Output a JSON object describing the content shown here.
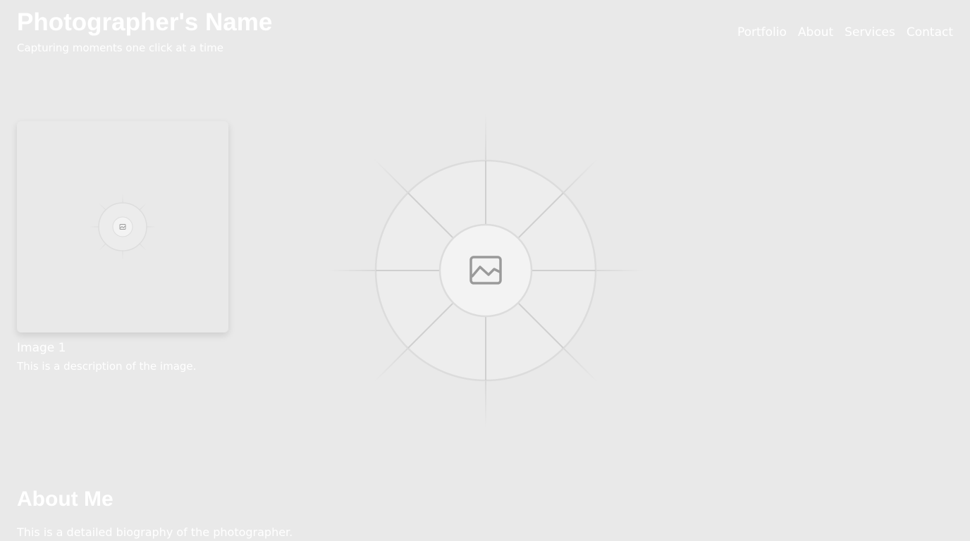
{
  "header": {
    "title": "Photographer's Name",
    "tagline": "Capturing moments one click at a time"
  },
  "nav": {
    "items": [
      "Portfolio",
      "About",
      "Services",
      "Contact"
    ]
  },
  "gallery": {
    "items": [
      {
        "title": "Image 1",
        "description": "This is a description of the image.",
        "icon": "image-placeholder-icon"
      }
    ]
  },
  "hero": {
    "icon": "image-placeholder-icon"
  },
  "about": {
    "heading": "About Me",
    "text": "This is a detailed biography of the photographer."
  },
  "colors": {
    "background": "#e9e9e9",
    "text": "#ffffff",
    "placeholder_line": "#cfcfcf",
    "placeholder_icon": "#9a9a9a"
  }
}
